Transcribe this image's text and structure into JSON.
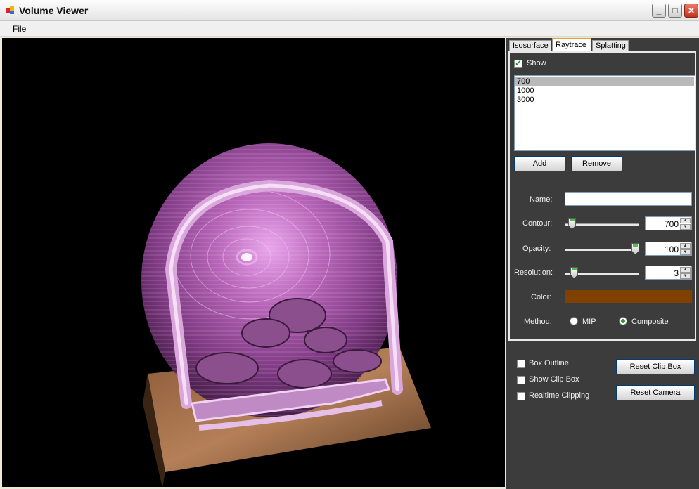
{
  "window": {
    "title": "Volume Viewer"
  },
  "menu": {
    "file_label": "File"
  },
  "tabs": [
    {
      "label": "Isosurface"
    },
    {
      "label": "Raytrace"
    },
    {
      "label": "Splatting"
    }
  ],
  "raytrace": {
    "show_label": "Show",
    "show_checked": true,
    "contours": [
      "700",
      "1000",
      "3000"
    ],
    "add_label": "Add",
    "remove_label": "Remove",
    "name_label": "Name:",
    "name_value": "",
    "contour_label": "Contour:",
    "contour_value": "700",
    "opacity_label": "Opacity:",
    "opacity_value": "100",
    "resolution_label": "Resolution:",
    "resolution_value": "3",
    "color_label": "Color:",
    "color_hex": "#804000",
    "method_label": "Method:",
    "method_mip": "MIP",
    "method_composite": "Composite"
  },
  "options": {
    "box_outline": "Box Outline",
    "show_clip_box": "Show Clip Box",
    "realtime_clipping": "Realtime Clipping",
    "reset_clip_box": "Reset Clip Box",
    "reset_camera": "Reset Camera"
  }
}
